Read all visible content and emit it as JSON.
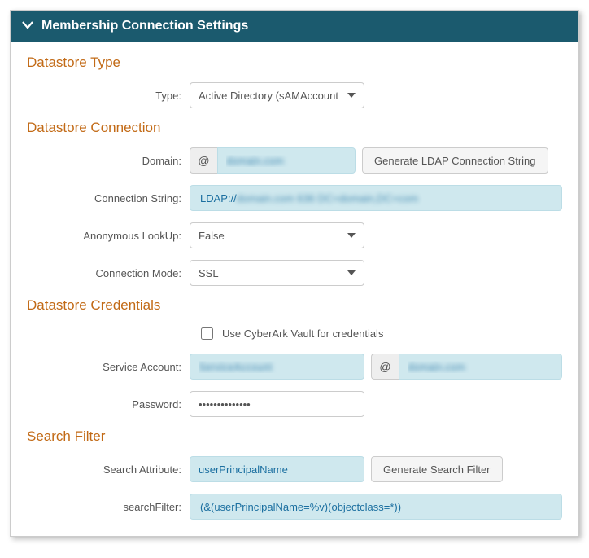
{
  "header": {
    "title": "Membership Connection Settings"
  },
  "datastoreType": {
    "heading": "Datastore Type",
    "typeLabel": "Type:",
    "typeSelected": "Active Directory (sAMAccount"
  },
  "datastoreConnection": {
    "heading": "Datastore Connection",
    "domainLabel": "Domain:",
    "domainValue": "domain.com",
    "generateLdapBtn": "Generate LDAP Connection String",
    "connStringLabel": "Connection String:",
    "connStringPrefix": "LDAP://",
    "connStringBlurred": "domain.com 636 DC=domain,DC=com",
    "anonLookupLabel": "Anonymous LookUp:",
    "anonLookupSelected": "False",
    "connModeLabel": "Connection Mode:",
    "connModeSelected": "SSL"
  },
  "datastoreCredentials": {
    "heading": "Datastore Credentials",
    "cyberarkLabel": "Use CyberArk Vault for credentials",
    "serviceAccountLabel": "Service Account:",
    "serviceAccountValue": "ServiceAccount",
    "serviceAccountDomain": "domain.com",
    "passwordLabel": "Password:",
    "passwordValue": "••••••••••••••"
  },
  "searchFilter": {
    "heading": "Search Filter",
    "searchAttrLabel": "Search Attribute:",
    "searchAttrValue": "userPrincipalName",
    "generateFilterBtn": "Generate Search Filter",
    "searchFilterLabel": "searchFilter:",
    "searchFilterValue": "(&(userPrincipalName=%v)(objectclass=*))"
  }
}
